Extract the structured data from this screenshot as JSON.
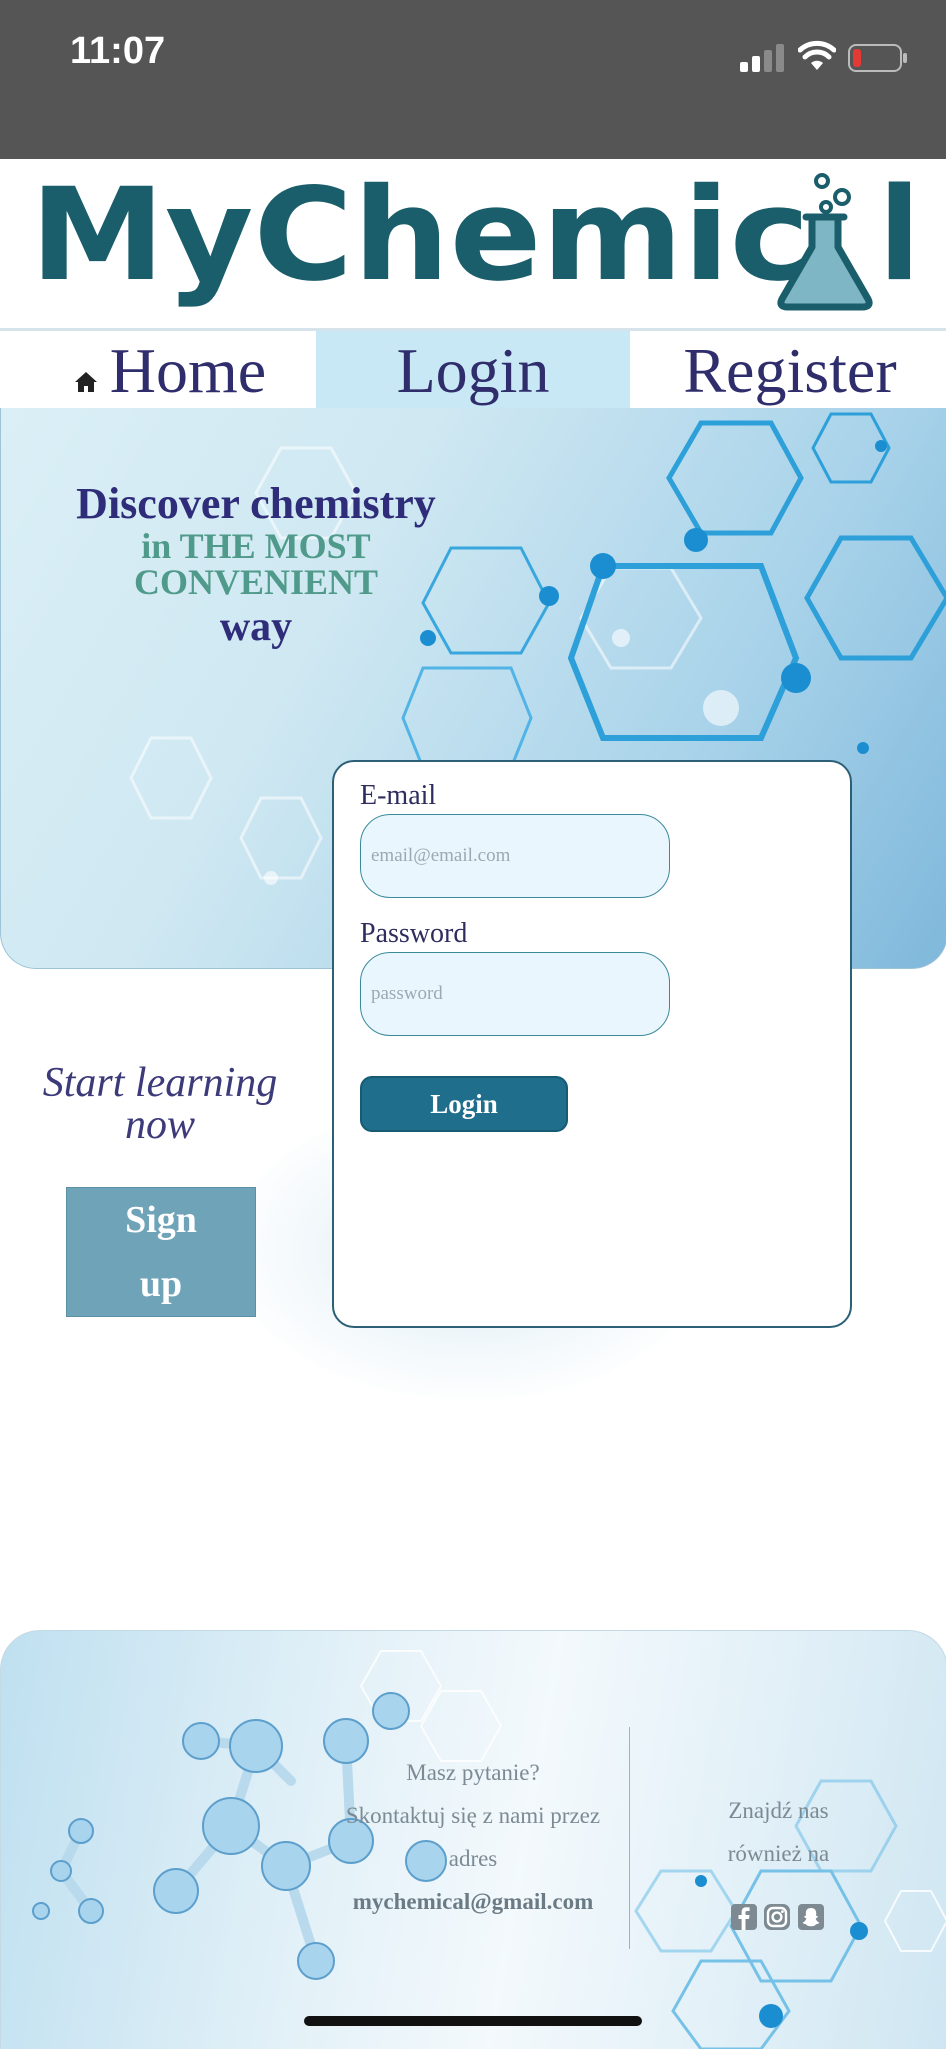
{
  "status_bar": {
    "time": "11:07",
    "battery_color": "#e53935"
  },
  "logo": {
    "text": "MyChemic",
    "last_letter": "l",
    "color": "#1b5e6b",
    "icon": "flask-icon"
  },
  "nav": {
    "home": "Home",
    "login": "Login",
    "register": "Register",
    "active": "Login",
    "home_icon": "home-icon"
  },
  "hero": {
    "line1": "Discover chemistry",
    "line2": "in THE MOST",
    "line2b": "CONVENIENT",
    "line3": "way"
  },
  "cta": {
    "text": "Start learning now",
    "signup_label": "Sign\nup"
  },
  "login_form": {
    "email_label": "E-mail",
    "email_placeholder": "email@email.com",
    "password_label": "Password",
    "password_placeholder": "password",
    "submit_label": "Login"
  },
  "footer": {
    "question": "Masz pytanie?",
    "contact_line": "Skontaktuj się z nami przez adres",
    "email": "mychemical@gmail.com",
    "find_us": "Znajdź nas również na",
    "social": [
      "facebook-icon",
      "instagram-icon",
      "snapchat-icon"
    ]
  },
  "colors": {
    "accent": "#1f6e8c",
    "nav_active": "#c8e8f5",
    "text_dark": "#2f2d6b",
    "signup": "#6ea3b8"
  }
}
